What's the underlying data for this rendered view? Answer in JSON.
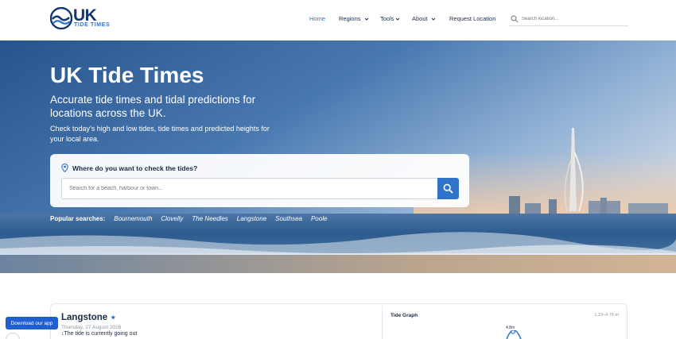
{
  "brand": {
    "name": "UK",
    "subtitle": "TIDE TIMES",
    "colors": {
      "primary": "#13386f",
      "accent": "#2f74c8",
      "app_button": "#1f5fd0"
    }
  },
  "nav": {
    "items": [
      {
        "label": "Home",
        "active": true,
        "dropdown": false
      },
      {
        "label": "Regions",
        "active": false,
        "dropdown": true
      },
      {
        "label": "Tools",
        "active": false,
        "dropdown": true
      },
      {
        "label": "About",
        "active": false,
        "dropdown": true
      },
      {
        "label": "Request Location",
        "active": false,
        "dropdown": false
      }
    ],
    "search_placeholder": "Search location..."
  },
  "hero": {
    "title": "UK Tide Times",
    "subtitle": "Accurate tide times and tidal predictions for locations across the UK.",
    "description": "Check today's high and low tides, tide times and predicted heights for your local area.",
    "search_question": "Where do you want to check the tides?",
    "search_placeholder": "Search for a beach, harbour or town...",
    "popular_label": "Popular searches:",
    "popular": [
      "Bournemouth",
      "Clovelly",
      "The Needles",
      "Langstone",
      "Southsea",
      "Poole"
    ]
  },
  "location_card": {
    "name": "Langstone",
    "favorite_icon": "star-icon",
    "date": "Thursday, 27 August 2026",
    "status": "↓The tide is currently going out",
    "graph_label": "Tide Graph",
    "graph_range": "1.23–4.76 m",
    "graph_peak": "4.8m"
  },
  "download_app": "Download our app"
}
